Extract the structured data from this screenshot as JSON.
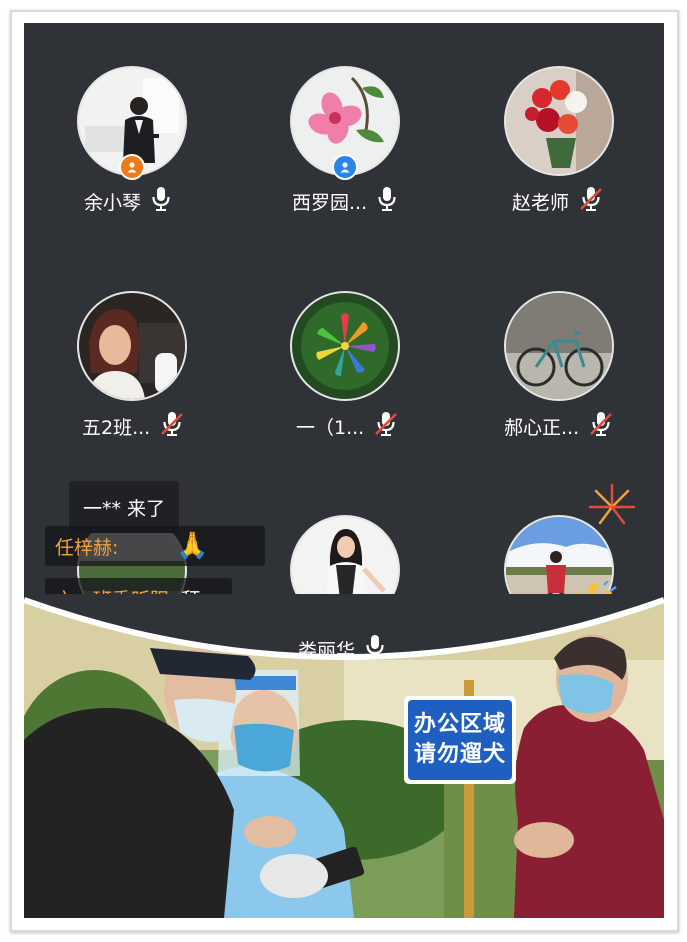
{
  "participants": [
    {
      "name": "余小琴",
      "mic": "on",
      "badge": "orange"
    },
    {
      "name": "西罗园...",
      "mic": "on",
      "badge": "blue"
    },
    {
      "name": "赵老师",
      "mic": "muted",
      "badge": null
    },
    {
      "name": "五2班...",
      "mic": "muted",
      "badge": null
    },
    {
      "name": "一（1...",
      "mic": "muted",
      "badge": null
    },
    {
      "name": "郝心正...",
      "mic": "muted",
      "badge": null
    },
    {
      "name": "",
      "mic": "",
      "badge": null
    },
    {
      "name": "娄丽华",
      "mic": "on",
      "badge": null
    },
    {
      "name": "",
      "mic": "",
      "badge": null
    }
  ],
  "join_notice": "一** 来了",
  "chat": [
    {
      "sender": "任梓赫:",
      "message": "🙏"
    },
    {
      "sender": "六一班季昕阳:",
      "message": "拜 ~"
    }
  ],
  "photo": {
    "sign_line1": "办公区域",
    "sign_line2": "请勿遛犬"
  },
  "colors": {
    "panel_bg": "#2f3236",
    "chat_sender": "#f0a23c",
    "muted_slash": "#e24a3b",
    "badge_orange": "#f07a1a",
    "badge_blue": "#2a86e6",
    "sign_blue": "#1f5fc2"
  }
}
